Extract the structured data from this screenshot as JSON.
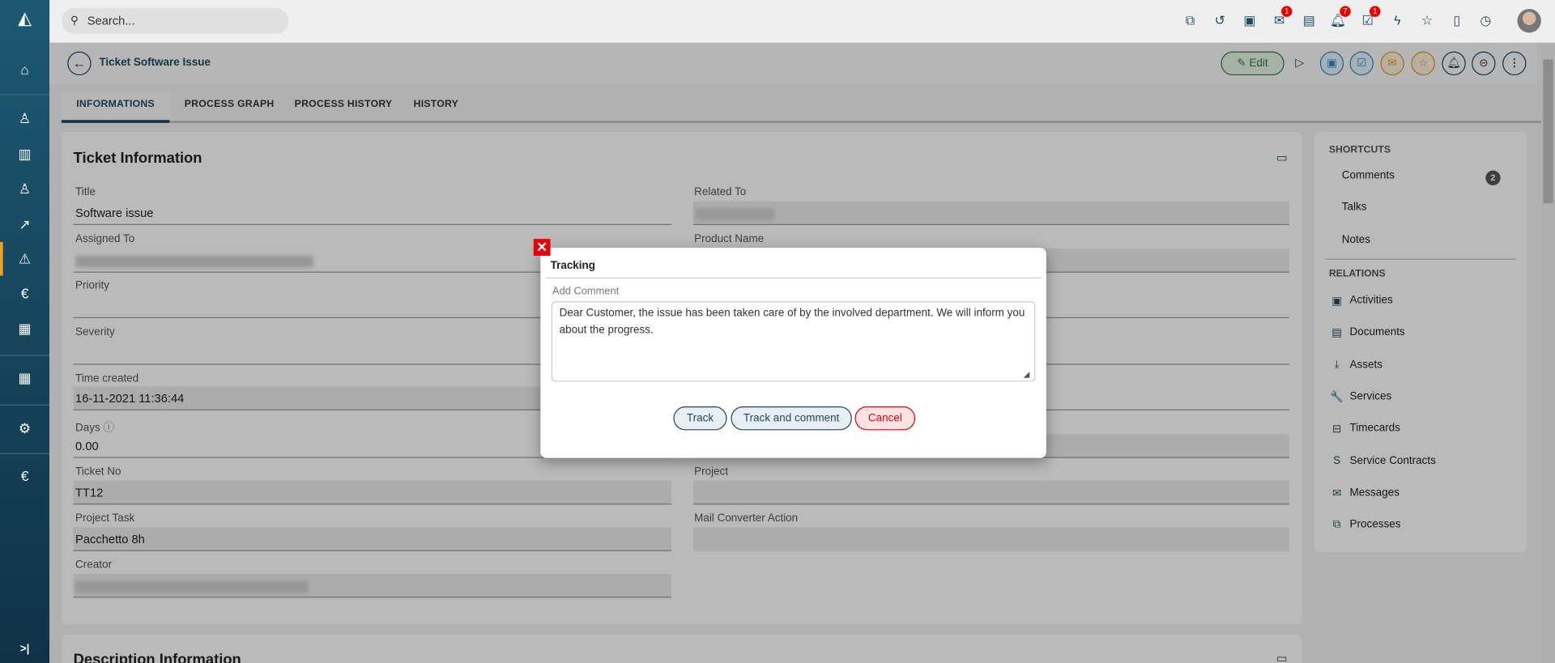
{
  "sidebar": {
    "items": [
      "logo",
      "home-icon",
      "user-icon",
      "building-icon",
      "contact-icon",
      "trend-icon",
      "warning-icon",
      "euro-icon",
      "table-icon",
      "grid-icon",
      "gear-icon",
      "euro-icon"
    ],
    "active": "warning-icon",
    "expand_label": ">|"
  },
  "topbar": {
    "search_placeholder": "Search...",
    "badges": {
      "mail": "1",
      "notifications": "7",
      "tasks": "1"
    }
  },
  "header": {
    "title": "Ticket Software Issue",
    "edit_label": "Edit"
  },
  "tabs": [
    {
      "label": "INFORMATIONS",
      "active": true
    },
    {
      "label": "PROCESS GRAPH"
    },
    {
      "label": "PROCESS HISTORY"
    },
    {
      "label": "HISTORY"
    }
  ],
  "ticket": {
    "heading": "Ticket Information",
    "left": [
      {
        "label": "Title",
        "value": "Software issue"
      },
      {
        "label": "Assigned To",
        "value": ""
      },
      {
        "label": "Priority",
        "value": ""
      },
      {
        "label": "Severity",
        "value": ""
      },
      {
        "label": "Time created",
        "value": "16-11-2021 11:36:44"
      },
      {
        "label": "Days",
        "value": "0.00"
      },
      {
        "label": "Ticket No",
        "value": "TT12"
      },
      {
        "label": "Project Task",
        "value": "Pacchetto 8h"
      },
      {
        "label": "Creator",
        "value": ""
      }
    ],
    "right": [
      {
        "label": "Related To",
        "value": ""
      },
      {
        "label": "Product Name",
        "value": ""
      },
      {
        "label": "Project",
        "value": ""
      },
      {
        "label": "Mail Converter Action",
        "value": ""
      }
    ]
  },
  "description_heading": "Description Information",
  "shortcuts": {
    "heading": "SHORTCUTS",
    "items": [
      {
        "label": "Comments",
        "count": "2"
      },
      {
        "label": "Talks"
      },
      {
        "label": "Notes"
      }
    ]
  },
  "relations": {
    "heading": "RELATIONS",
    "items": [
      {
        "label": "Activities",
        "icon": "calendar-icon",
        "glyph": "▣"
      },
      {
        "label": "Documents",
        "icon": "folder-icon",
        "glyph": "▤"
      },
      {
        "label": "Assets",
        "icon": "download-icon",
        "glyph": "⤓"
      },
      {
        "label": "Services",
        "icon": "wrench-icon",
        "glyph": "🔧"
      },
      {
        "label": "Timecards",
        "icon": "briefcase-icon",
        "glyph": "⊟"
      },
      {
        "label": "Service Contracts",
        "icon": "s-icon",
        "glyph": "S"
      },
      {
        "label": "Messages",
        "icon": "mail-icon",
        "glyph": "✉"
      },
      {
        "label": "Processes",
        "icon": "process-icon",
        "glyph": "⧉"
      }
    ]
  },
  "dialog": {
    "title": "Tracking",
    "field_label": "Add Comment",
    "comment": "Dear Customer, the issue has been taken care of by the involved department. We will inform you about the progress.",
    "track": "Track",
    "track_comment": "Track and comment",
    "cancel": "Cancel"
  },
  "colors": {
    "brand": "#1c4a63",
    "accent": "#f0a020",
    "danger": "#e8000b"
  }
}
